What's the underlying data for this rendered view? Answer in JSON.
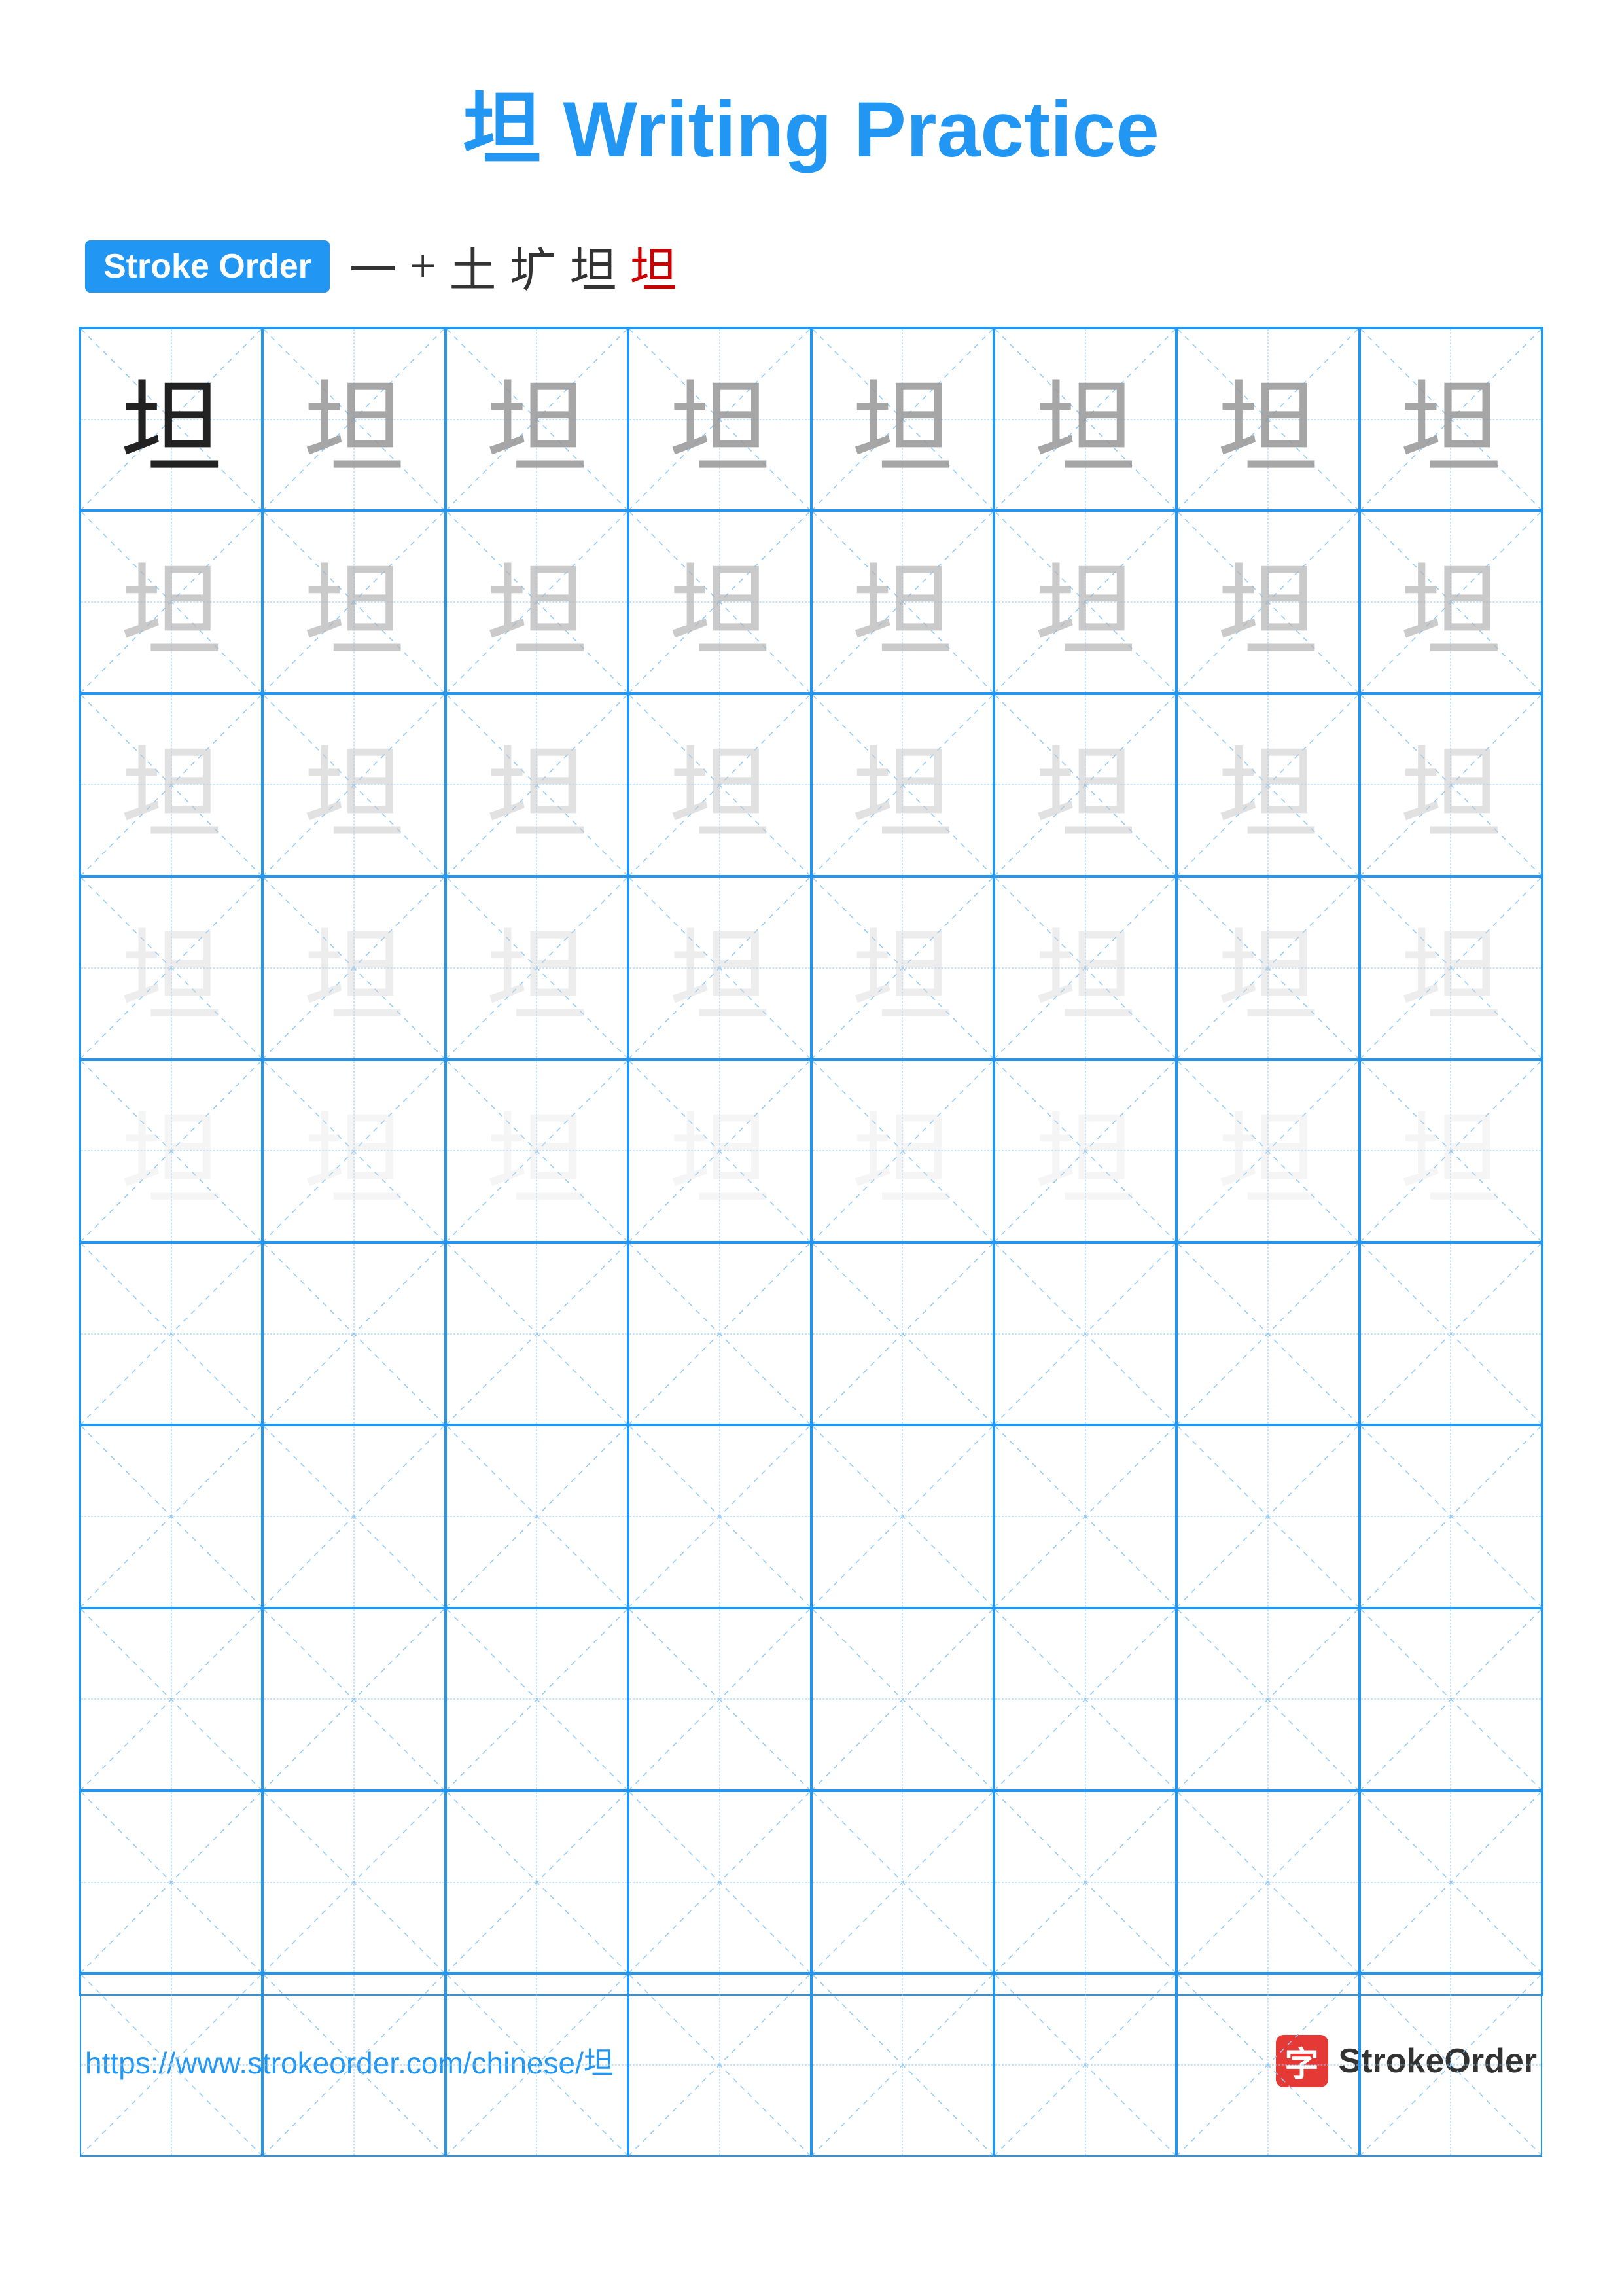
{
  "title": {
    "char": "坦",
    "text": " Writing Practice",
    "full": "坦 Writing Practice"
  },
  "stroke_order": {
    "badge": "Stroke Order",
    "strokes": [
      "一",
      "十",
      "土",
      "圹",
      "坦",
      "坦"
    ]
  },
  "grid": {
    "rows": 10,
    "cols": 8,
    "char": "坦",
    "row_opacities": [
      "solid",
      "80",
      "60",
      "40",
      "20",
      "empty",
      "empty",
      "empty",
      "empty",
      "empty"
    ]
  },
  "footer": {
    "url": "https://www.strokeorder.com/chinese/坦",
    "logo_text": "StrokeOrder",
    "logo_char": "字"
  }
}
